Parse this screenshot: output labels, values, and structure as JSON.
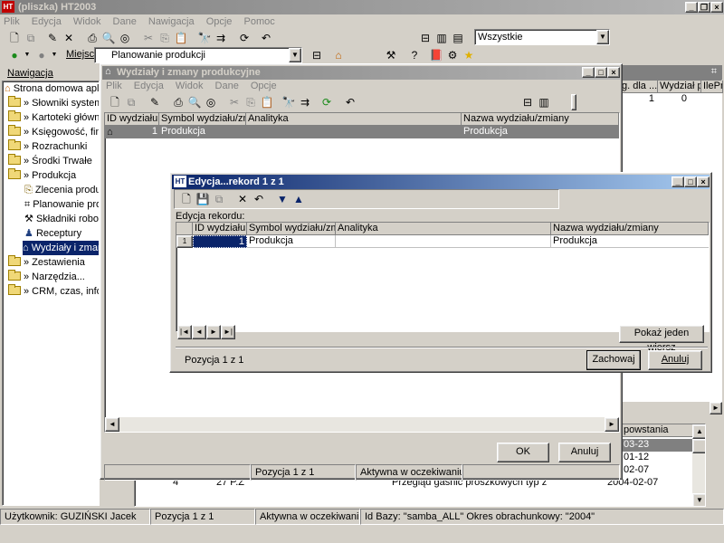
{
  "app": {
    "title": "(pliszka)  HT2003",
    "menu": [
      "Plik",
      "Edycja",
      "Widok",
      "Dane",
      "Nawigacja",
      "Opcje",
      "Pomoc"
    ],
    "filter_value": "Wszystkie",
    "location_label": "Miejsce",
    "location_value": "Planowanie produkcji"
  },
  "navigation": {
    "header": "Nawigacja",
    "items": [
      "Strona domowa aplikac",
      "» Słowniki systemowe",
      "» Kartoteki główne",
      "» Księgowość, finanse",
      "» Rozrachunki",
      "» Środki Trwałe",
      "» Produkcja",
      "Zlecenia produkc",
      "Planowanie produ",
      "Składniki robocizr",
      "Receptury",
      "Wydziały i zmany",
      "» Zestawienia",
      "» Narzędzia...",
      "» CRM, czas, informacj"
    ]
  },
  "bg_grid": {
    "headers": [
      "g. dla ...",
      "Wydział p...",
      "IlePr"
    ],
    "row": [
      "1",
      "0"
    ]
  },
  "bg_lower": {
    "header": "powstania",
    "dates": [
      "03-23",
      "01-12",
      "02-07",
      "02-07"
    ],
    "last_row": {
      "num": "4",
      "code": "27 P.Z",
      "desc": "Przegląd gaśnic proszkowych typ z",
      "date": "2004-02-07"
    }
  },
  "mdi": {
    "title": "Wydziały i zmany produkcyjne",
    "menu": [
      "Plik",
      "Edycja",
      "Widok",
      "Dane",
      "Opcje"
    ],
    "columns": [
      "ID wydziału",
      "Symbol wydziału/zmiany",
      "Analityka",
      "Nazwa wydziału/zmiany"
    ],
    "row": {
      "id": "1",
      "symbol": "Produkcja",
      "analityka": "",
      "nazwa": "Produkcja"
    },
    "ok": "OK",
    "cancel": "Anuluj",
    "status": [
      "Pozycja 1 z 1",
      "Aktywna w oczekiwaniu"
    ]
  },
  "dialog": {
    "title": "Edycja...rekord 1 z 1",
    "section": "Edycja rekordu:",
    "columns": [
      "ID wydziału",
      "Symbol wydziału/zmiany",
      "Analityka",
      "Nazwa wydziału/zmiany"
    ],
    "row": {
      "marker": "1",
      "id": "1",
      "symbol": "Produkcja",
      "analityka": "",
      "nazwa": "Produkcja"
    },
    "show_one": "Pokaż jeden wiersz",
    "position": "Pozycja 1 z 1",
    "save": "Zachowaj",
    "cancel": "Anuluj"
  },
  "statusbar": {
    "user": "Użytkownik: GUZIŃSKI Jacek",
    "position": "Pozycja 1 z 1",
    "state": "Aktywna w oczekiwaniu",
    "db": "Id Bazy: \"samba_ALL\" Okres obrachunkowy: \"2004\""
  }
}
